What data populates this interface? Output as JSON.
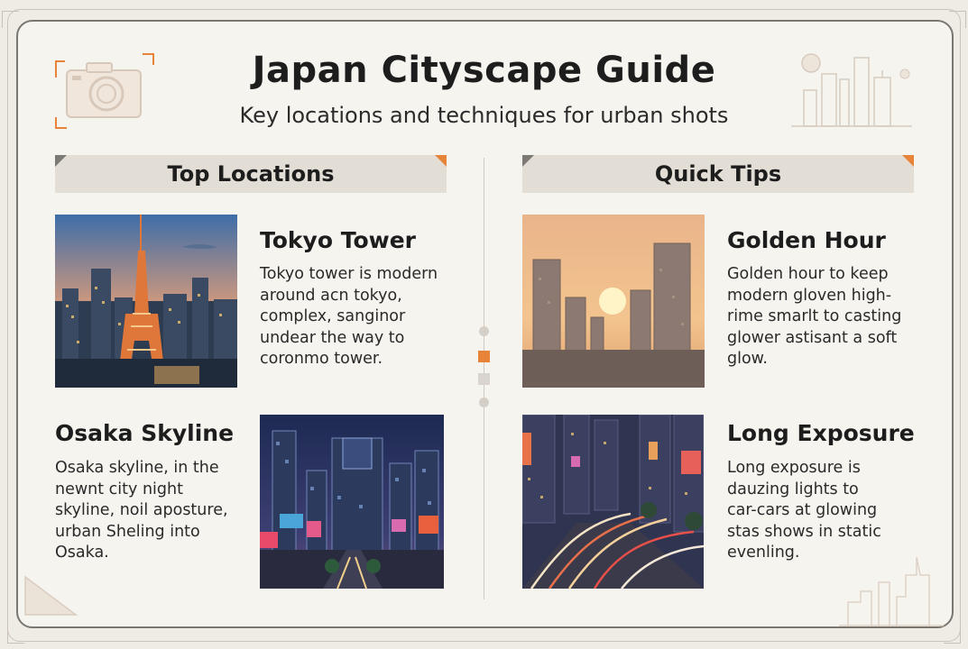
{
  "header": {
    "title": "Japan Cityscape Guide",
    "subtitle": "Key locations and techniques for urban shots"
  },
  "sections": {
    "left": {
      "label": "Top Locations"
    },
    "right": {
      "label": "Quick Tips"
    }
  },
  "cards": {
    "tokyo": {
      "title": "Tokyo Tower",
      "text": "Tokyo tower is modern\naround acn tokyo,\ncomplex, sanginor\nundear the way to\ncoronmo tower."
    },
    "osaka": {
      "title": "Osaka Skyline",
      "text": "Osaka skyline, in the\nnewnt city night\nskyline, noil aposture,\nurban Sheling into\nOsaka."
    },
    "golden": {
      "title": "Golden Hour",
      "text": "Golden hour to keep\nmodern gloven high-\nrime smarlt to casting\nglower astisant a soft\nglow."
    },
    "exposure": {
      "title": "Long Exposure",
      "text": "Long exposure is\ndauzing lights to\ncar-cars at glowing\nstas shows in static\nevenling."
    }
  },
  "icons": [
    "camera-icon",
    "skyline-icon"
  ],
  "colors": {
    "accent": "#e8833a",
    "bar": "#e2ded6",
    "frame": "#7a7670"
  }
}
